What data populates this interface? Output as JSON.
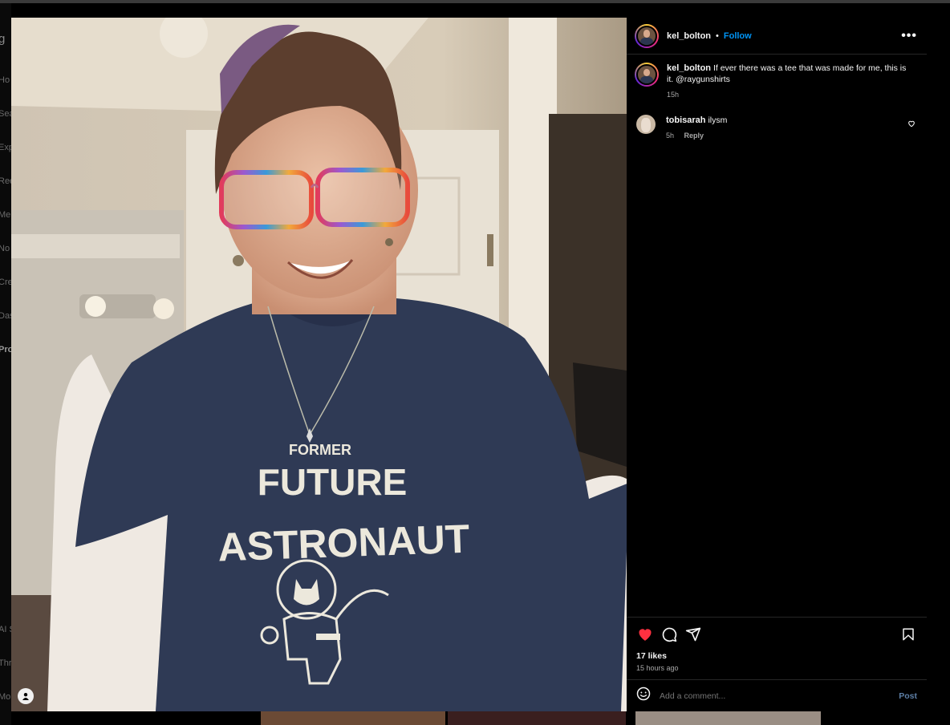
{
  "post": {
    "author": "kel_bolton",
    "follow_label": "Follow",
    "separator": "•",
    "more_label": "•••",
    "caption_user": "kel_bolton",
    "caption_text": "If ever there was a tee that was made for me, this is it. @raygunshirts",
    "caption_time": "15h",
    "comments": [
      {
        "user": "tobisarah",
        "text": "ilysm",
        "time": "5h",
        "reply_label": "Reply"
      }
    ],
    "likes": "17 likes",
    "posted_ago": "15 hours ago",
    "comment_placeholder": "Add a comment...",
    "post_label": "Post",
    "liked": true
  },
  "photo_shirt": {
    "line1": "FORMER",
    "line2": "FUTURE",
    "line3": "ASTRONAUT"
  },
  "background_nav": [
    "Ho",
    "Sea",
    "Exp",
    "Ree",
    "Me",
    "No",
    "Cre",
    "Das",
    "Pro",
    "AI S",
    "Thr",
    "Mo"
  ],
  "colors": {
    "accent": "#0095f6",
    "like": "#ff3040",
    "panel_bg": "#000000",
    "border": "#262626",
    "muted": "#a8a8a8"
  },
  "icons": [
    "heart-icon",
    "comment-icon",
    "share-icon",
    "bookmark-icon",
    "emoji-icon",
    "more-icon"
  ]
}
